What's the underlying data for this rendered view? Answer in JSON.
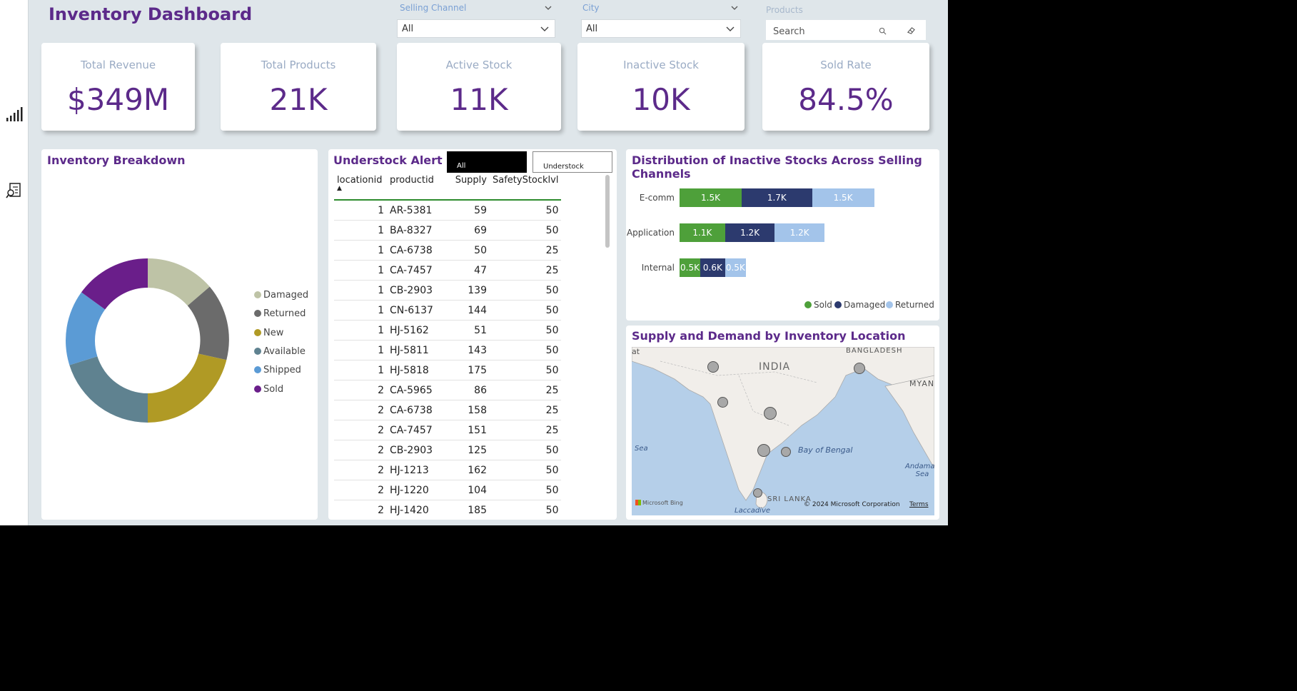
{
  "header": {
    "title": "Inventory Dashboard"
  },
  "filters": {
    "selling_channel": {
      "label": "Selling Channel",
      "value": "All"
    },
    "city": {
      "label": "City",
      "value": "All"
    },
    "products": {
      "label": "Products",
      "placeholder": "Search"
    }
  },
  "sidebar": {
    "icons": [
      "signal-bars-icon",
      "report-search-icon"
    ]
  },
  "kpis": [
    {
      "label": "Total Revenue",
      "value": "$349M"
    },
    {
      "label": "Total Products",
      "value": "21K"
    },
    {
      "label": "Active Stock",
      "value": "11K"
    },
    {
      "label": "Inactive Stock",
      "value": "10K"
    },
    {
      "label": "Sold Rate",
      "value": "84.5%"
    }
  ],
  "inventory_breakdown": {
    "title": "Inventory Breakdown",
    "legend": [
      "Damaged",
      "Returned",
      "New",
      "Available",
      "Shipped",
      "Sold"
    ],
    "colors": [
      "#bec3a6",
      "#6b6b6b",
      "#b09a25",
      "#5f8290",
      "#5b9bd5",
      "#6a1e8a"
    ]
  },
  "understock": {
    "title": "Understock Alert",
    "buttons": {
      "all": "All",
      "understock": "Understock"
    },
    "columns": [
      "locationid",
      "productid",
      "Supply",
      "SafetyStocklvl"
    ],
    "rows": [
      [
        "1",
        "AR-5381",
        "59",
        "50"
      ],
      [
        "1",
        "BA-8327",
        "69",
        "50"
      ],
      [
        "1",
        "CA-6738",
        "50",
        "25"
      ],
      [
        "1",
        "CA-7457",
        "47",
        "25"
      ],
      [
        "1",
        "CB-2903",
        "139",
        "50"
      ],
      [
        "1",
        "CN-6137",
        "144",
        "50"
      ],
      [
        "1",
        "HJ-5162",
        "51",
        "50"
      ],
      [
        "1",
        "HJ-5811",
        "143",
        "50"
      ],
      [
        "1",
        "HJ-5818",
        "175",
        "50"
      ],
      [
        "2",
        "CA-5965",
        "86",
        "25"
      ],
      [
        "2",
        "CA-6738",
        "158",
        "25"
      ],
      [
        "2",
        "CA-7457",
        "151",
        "25"
      ],
      [
        "2",
        "CB-2903",
        "125",
        "50"
      ],
      [
        "2",
        "HJ-1213",
        "162",
        "50"
      ],
      [
        "2",
        "HJ-1220",
        "104",
        "50"
      ],
      [
        "2",
        "HJ-1420",
        "185",
        "50"
      ]
    ]
  },
  "distribution": {
    "title": "Distribution of Inactive Stocks Across Selling Channels",
    "legend": [
      "Sold",
      "Damaged",
      "Returned"
    ],
    "colors": {
      "Sold": "#4ea03a",
      "Damaged": "#2c3a6e",
      "Returned": "#a3c4ea"
    }
  },
  "chart_data": {
    "type": "bar",
    "orientation": "horizontal",
    "stacked": true,
    "title": "Distribution of Inactive Stocks Across Selling Channels",
    "categories": [
      "E-comm",
      "Application",
      "Internal"
    ],
    "series": [
      {
        "name": "Sold",
        "values": [
          1.5,
          1.1,
          0.5
        ],
        "labels": [
          "1.5K",
          "1.1K",
          "0.5K"
        ]
      },
      {
        "name": "Damaged",
        "values": [
          1.7,
          1.2,
          0.6
        ],
        "labels": [
          "1.7K",
          "1.2K",
          "0.6K"
        ]
      },
      {
        "name": "Returned",
        "values": [
          1.5,
          1.2,
          0.5
        ],
        "labels": [
          "1.5K",
          "1.2K",
          "0.5K"
        ]
      }
    ],
    "xlim": [
      0,
      5.5
    ],
    "legend": "bottom-right",
    "grid": false
  },
  "map": {
    "title": "Supply and Demand by Inventory Location",
    "labels": {
      "india": "INDIA",
      "bangladesh": "BANGLADESH",
      "myanmar": "MYANMA",
      "bay": "Bay of Bengal",
      "sea": "Sea",
      "sri_lanka": "SRI LANKA",
      "andaman": "Andaman\nSea",
      "laccadive": "Laccadive",
      "edge": "at"
    },
    "attribution": "© 2024 Microsoft Corporation",
    "terms": "Terms",
    "brand": "Microsoft Bing"
  }
}
